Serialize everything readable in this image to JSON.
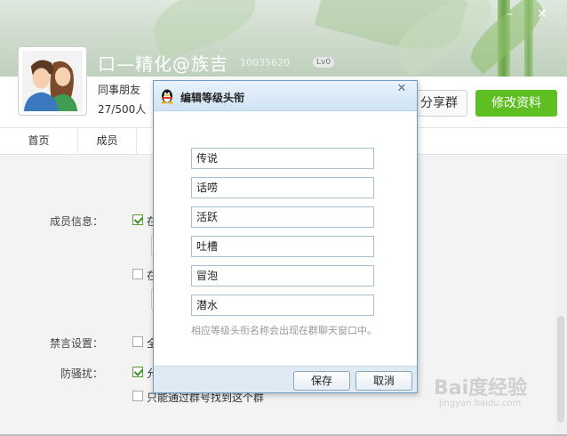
{
  "group": {
    "name": "口—精化@族吉",
    "number": "10035620",
    "level_badge": "Lv0",
    "category": "同事朋友",
    "member_count": "27/500人"
  },
  "actions": {
    "share_label": "分享群",
    "edit_label": "修改资料"
  },
  "nav": {
    "tabs": [
      {
        "label": "首页"
      },
      {
        "label": "成员"
      }
    ]
  },
  "settings": {
    "member_info_label": "成员信息：",
    "member_info_opt1": "在",
    "member_info_opt1_checked": true,
    "member_info_opt2": "在",
    "member_info_opt2_checked": false,
    "mute_label": "禁言设置：",
    "mute_opt": "全",
    "mute_checked": false,
    "anti_harass_label": "防骚扰：",
    "anti_harass_opt1": "允",
    "anti_harass_opt1_checked": true,
    "anti_harass_opt2": "只能通过群号找到这个群",
    "anti_harass_opt2_checked": false
  },
  "dialog": {
    "title": "编辑等级头衔",
    "close_glyph": "✕",
    "titles": [
      {
        "value": "传说"
      },
      {
        "value": "话唠"
      },
      {
        "value": "活跃"
      },
      {
        "value": "吐槽"
      },
      {
        "value": "冒泡"
      },
      {
        "value": "潜水"
      }
    ],
    "hint": "相应等级头衔名称会出现在群聊天窗口中。",
    "save_label": "保存",
    "cancel_label": "取消"
  },
  "window_controls": {
    "minimize": "–",
    "close": "✕"
  },
  "watermark": {
    "main": "Bai度经验",
    "sub": "jingyan.baidu.com"
  },
  "colors": {
    "accent_green": "#5fbe21",
    "dialog_border": "#6d9cc8"
  }
}
